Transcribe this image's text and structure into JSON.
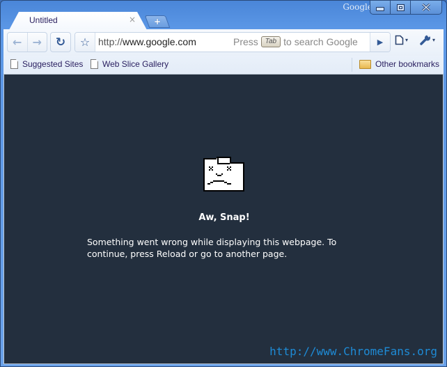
{
  "window": {
    "brand": "Google",
    "controls": {
      "minimize": "minimize",
      "maximize": "maximize",
      "close": "close"
    }
  },
  "tabs": [
    {
      "title": "Untitled",
      "close_icon": "×"
    }
  ],
  "new_tab_icon": "+",
  "toolbar": {
    "back_icon": "←",
    "forward_icon": "→",
    "reload_icon": "↻",
    "star_icon": "☆",
    "url_prefix": "http://",
    "url_host": "www.google.com",
    "hint_press": "Press",
    "hint_key": "Tab",
    "hint_suffix": "to search Google",
    "go_icon": "▶",
    "page_menu_icon": "🗋",
    "wrench_icon": "🔧",
    "caret": "▾"
  },
  "bookmarks": {
    "items": [
      {
        "label": "Suggested Sites"
      },
      {
        "label": "Web Slice Gallery"
      }
    ],
    "other": "Other bookmarks"
  },
  "content": {
    "background": "#232f3e",
    "title": "Aw, Snap!",
    "message": "Something went wrong while displaying this webpage. To continue, press Reload or go to another page.",
    "watermark": "http://www.ChromeFans.org",
    "watermark_color": "#1e8bd6"
  }
}
